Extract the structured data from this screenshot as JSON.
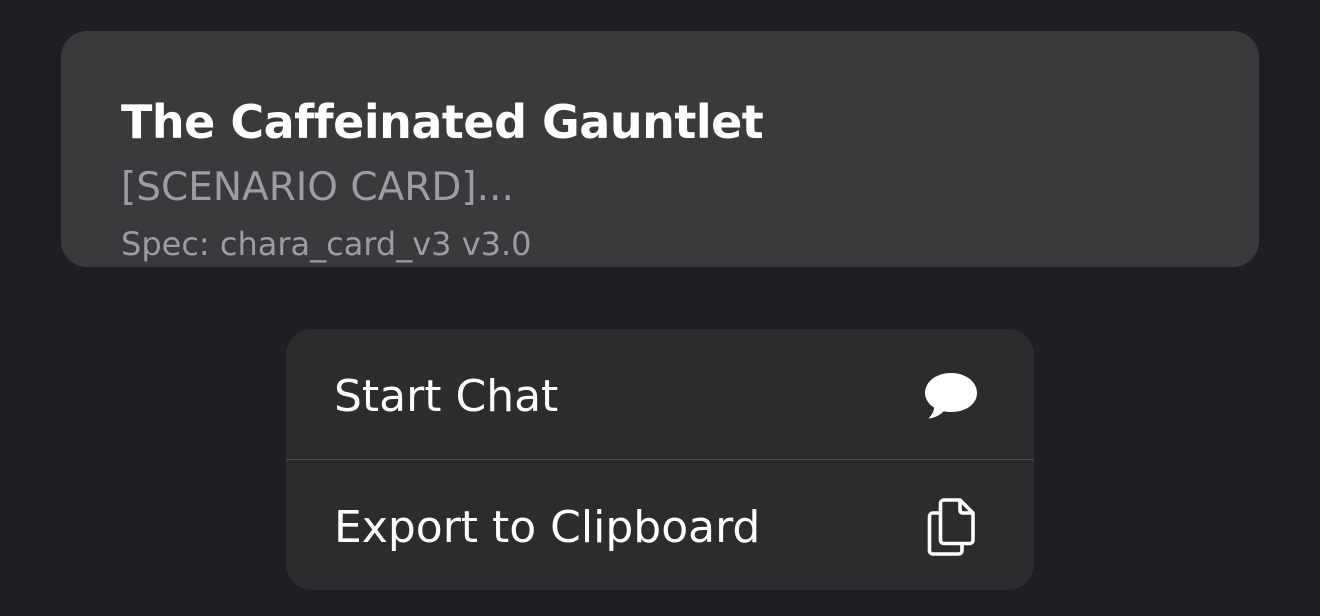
{
  "card": {
    "title": "The Caffeinated Gauntlet",
    "description": "[SCENARIO CARD]...",
    "spec": "Spec: chara_card_v3  v3.0"
  },
  "menu": {
    "items": [
      {
        "label": "Start Chat",
        "icon": "chat-bubble-icon"
      },
      {
        "label": "Export to Clipboard",
        "icon": "copy-documents-icon"
      }
    ]
  },
  "colors": {
    "background": "#1f1f23",
    "card_background": "#3a3a3c",
    "menu_background": "#2c2c2e",
    "primary_text": "#ffffff",
    "secondary_text": "#9c9ca2"
  }
}
